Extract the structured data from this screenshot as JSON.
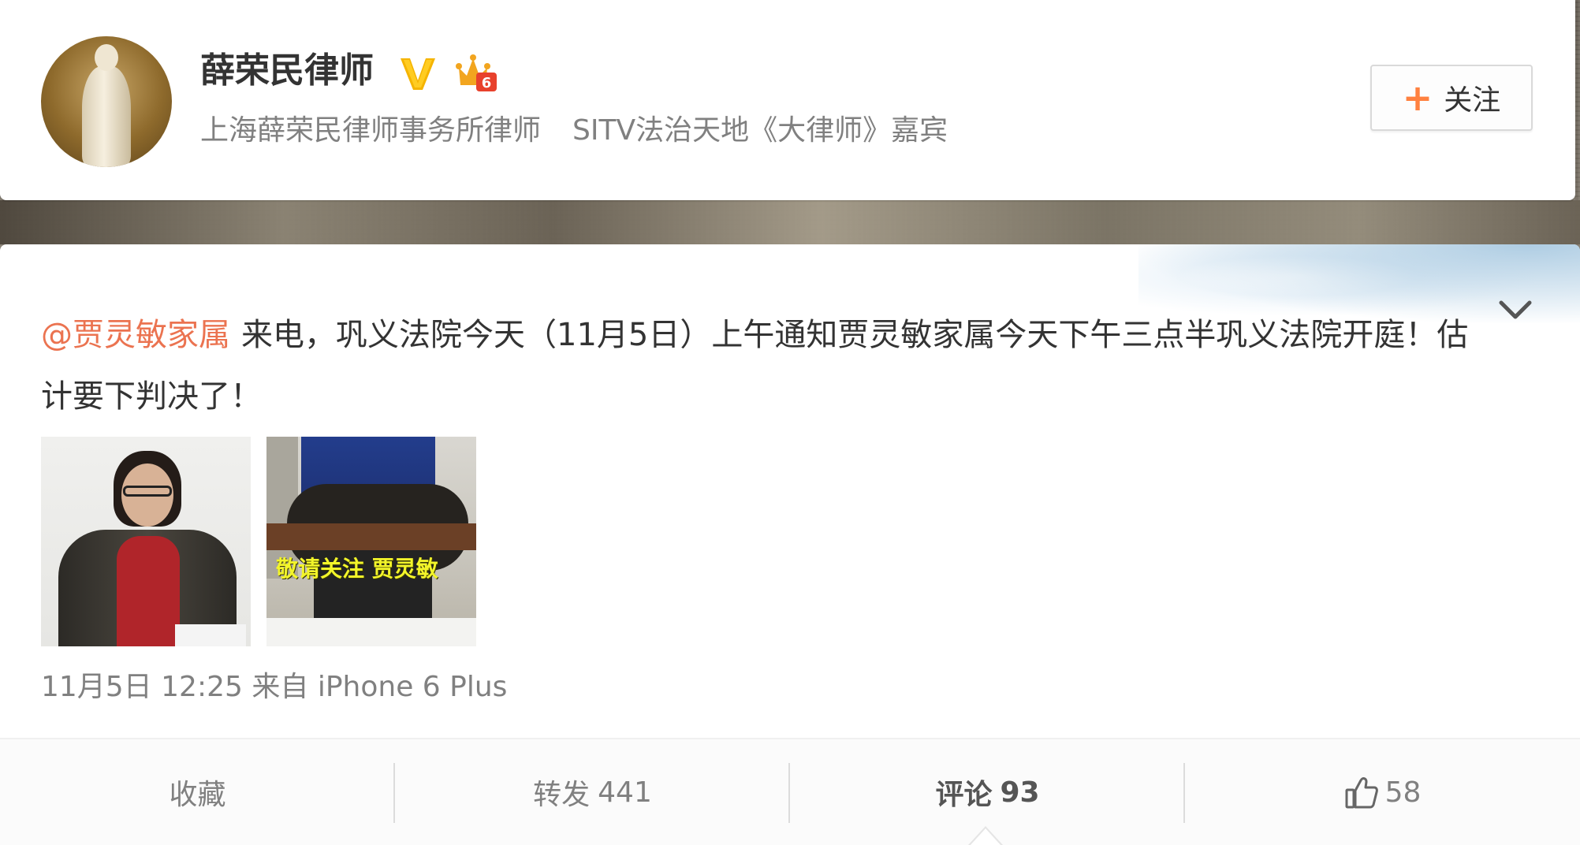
{
  "user": {
    "name": "薛荣民律师",
    "description_1": "上海薛荣民律师事务所律师",
    "description_2": "SITV法治天地《大律师》嘉宾",
    "verified_icon": "verified-v-icon",
    "member_icon": "vip-crown-icon"
  },
  "follow": {
    "label": "关注",
    "icon": "plus-icon"
  },
  "post": {
    "mention": "@贾灵敏家属",
    "text": "来电，巩义法院今天（11月5日）上午通知贾灵敏家属今天下午三点半巩义法院开庭！估计要下判决了！",
    "image_2_caption": "敬请关注  贾灵敏",
    "time": "11月5日 12:25",
    "from_label": "来自",
    "source": "iPhone 6 Plus"
  },
  "actions": {
    "favorite_label": "收藏",
    "repost_label": "转发",
    "repost_count": "441",
    "comment_label": "评论",
    "comment_count": "93",
    "like_count": "58"
  },
  "colors": {
    "mention": "#eb7350",
    "follow_plus": "#ff8140",
    "text": "#333333",
    "meta": "#808080"
  }
}
